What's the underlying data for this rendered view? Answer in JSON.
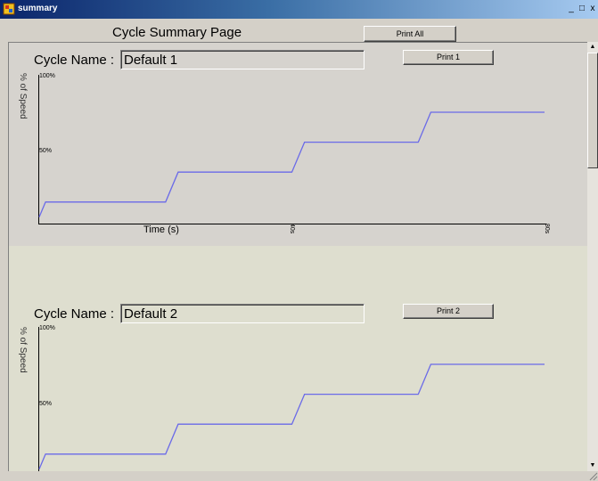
{
  "window": {
    "title": "summary",
    "minimize": "_",
    "maximize": "□",
    "close": "x"
  },
  "page_title": "Cycle Summary Page",
  "print_all_label": "Print All",
  "cycles": [
    {
      "name_label": "Cycle Name :",
      "name": "Default 1",
      "print_label": "Print 1",
      "ylabel": "% of Speed",
      "y_top_tick": "100%",
      "y_mid_tick": "50%",
      "xlabel": "Time (s)",
      "x_mid_tick": "40s",
      "x_end_tick": "80s"
    },
    {
      "name_label": "Cycle Name :",
      "name": "Default 2",
      "print_label": "Print 2",
      "ylabel": "% of Speed",
      "y_top_tick": "100%",
      "y_mid_tick": "50%"
    }
  ],
  "chart_data": [
    {
      "type": "line",
      "xlabel": "Time (s)",
      "ylabel": "% of Speed",
      "xlim": [
        0,
        80
      ],
      "ylim": [
        0,
        100
      ],
      "x": [
        0,
        1,
        20,
        22,
        40,
        42,
        60,
        62,
        80
      ],
      "y": [
        5,
        15,
        15,
        35,
        35,
        55,
        55,
        75,
        75
      ],
      "line_color": "#6a6ae8"
    },
    {
      "type": "line",
      "ylabel": "% of Speed",
      "xlim": [
        0,
        80
      ],
      "ylim": [
        0,
        100
      ],
      "x": [
        0,
        1,
        20,
        22,
        40,
        42,
        60,
        62,
        80
      ],
      "y": [
        5,
        15,
        15,
        35,
        35,
        55,
        55,
        75,
        75
      ],
      "line_color": "#6a6ae8"
    }
  ]
}
